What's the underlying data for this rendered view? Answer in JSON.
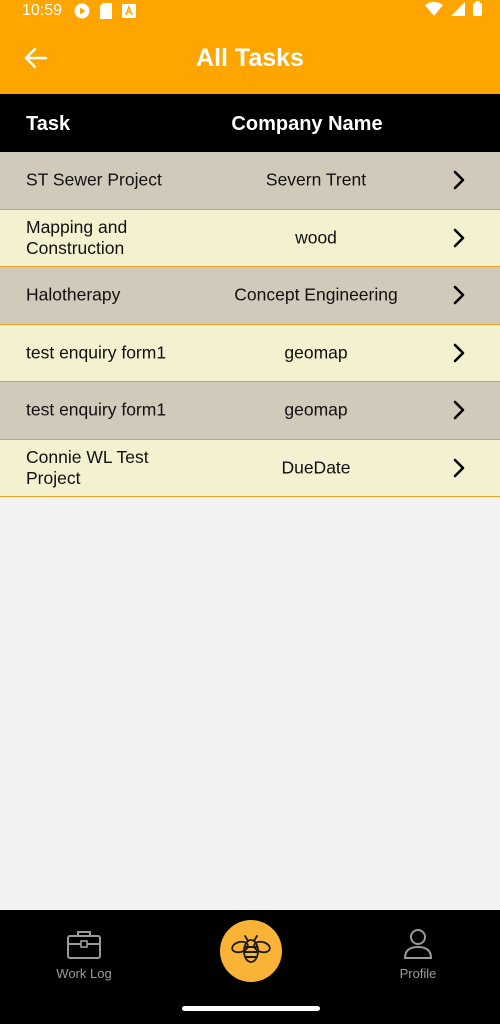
{
  "status": {
    "time": "10:59"
  },
  "appbar": {
    "title": "All Tasks",
    "back_icon": "arrow-left-icon"
  },
  "table": {
    "headers": {
      "task": "Task",
      "company": "Company Name"
    },
    "rows": [
      {
        "task": "ST Sewer Project",
        "company": "Severn Trent"
      },
      {
        "task": "Mapping and Construction",
        "company": "wood"
      },
      {
        "task": "Halotherapy",
        "company": "Concept Engineering"
      },
      {
        "task": "test enquiry form1",
        "company": "geomap"
      },
      {
        "task": "test enquiry form1",
        "company": "geomap"
      },
      {
        "task": "Connie WL Test Project",
        "company": "DueDate"
      }
    ]
  },
  "bottom_nav": {
    "worklog_label": "Work Log",
    "profile_label": "Profile",
    "center_icon": "bee-icon"
  },
  "colors": {
    "accent": "#ffa500",
    "row_a": "#d1c9b9",
    "row_b": "#f3f1d0",
    "fab": "#f9b437"
  }
}
